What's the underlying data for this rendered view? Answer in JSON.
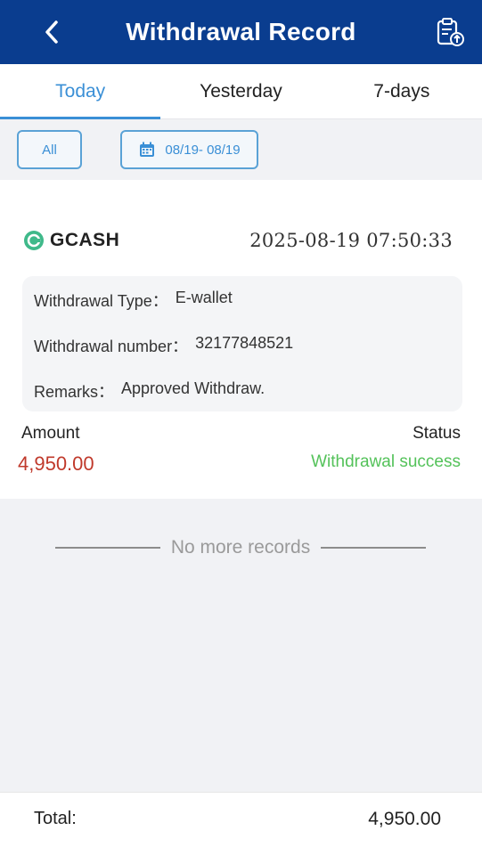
{
  "header": {
    "title": "Withdrawal Record"
  },
  "tabs": [
    {
      "label": "Today",
      "active": true
    },
    {
      "label": "Yesterday",
      "active": false
    },
    {
      "label": "7-days",
      "active": false
    }
  ],
  "filters": {
    "all_label": "All",
    "date_range": "08/19- 08/19"
  },
  "record": {
    "provider": "GCASH",
    "datetime": "2025-08-19  07:50:33",
    "type_label": "Withdrawal Type：",
    "type_value": "E-wallet",
    "number_label": "Withdrawal number：",
    "number_value": "32177848521",
    "remarks_label": "Remarks：",
    "remarks_value": "Approved Withdraw.",
    "amount_label": "Amount",
    "amount_value": "4,950.00",
    "status_label": "Status",
    "status_value": "Withdrawal success"
  },
  "no_more": "No more records",
  "footer": {
    "total_label": "Total:",
    "total_value": "4,950.00"
  },
  "colors": {
    "header_bg": "#0a3d8f",
    "accent": "#3a8fd6",
    "amount": "#c0392b",
    "success": "#54c25a"
  },
  "icons": [
    "back-arrow-icon",
    "clipboard-upload-icon",
    "calendar-icon",
    "gcash-logo-icon"
  ]
}
